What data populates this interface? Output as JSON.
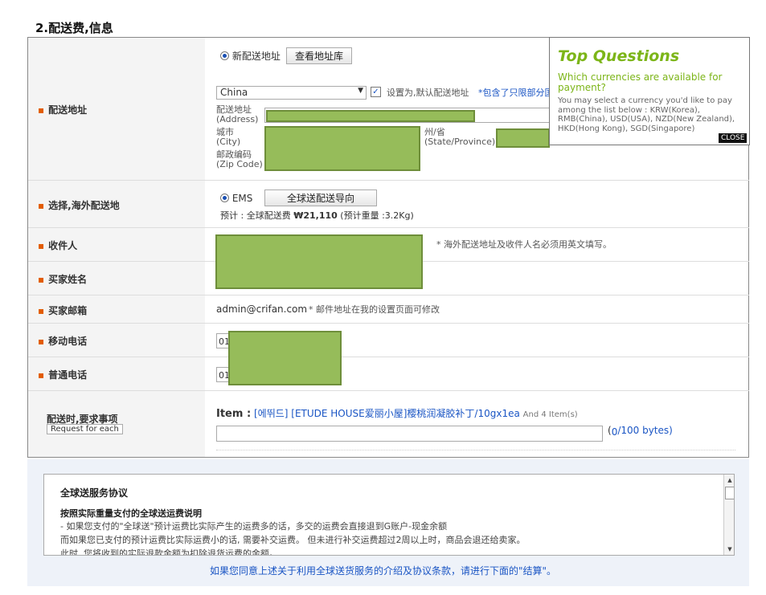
{
  "section_title": "2.配送费,信息",
  "address": {
    "label": "配送地址",
    "new_address_radio": "新配送地址",
    "view_book_button": "查看地址库",
    "country_select": "China",
    "default_checkbox_label": "设置为,默认配送地址",
    "default_note": "*包含了只限部分国",
    "address_label_cn": "配送地址",
    "address_label_en": "(Address)",
    "city_label_cn": "城市",
    "city_label_en": "(City)",
    "state_label_cn": "州/省",
    "state_label_en": "(State/Province)",
    "zip_label_cn": "邮政编码",
    "zip_label_en": "(Zip Code)"
  },
  "shipping": {
    "label": "选择,海外配送地",
    "radio": "EMS",
    "guide_button": "全球送配送导向",
    "estimate_prefix": "预计 : 全球配送费 ",
    "estimate_amount": "₩21,110",
    "estimate_suffix": " (预计重量 :3.2Kg)"
  },
  "recipient": {
    "label": "收件人",
    "note": "* 海外配送地址及收件人名必须用英文填写。"
  },
  "buyer_name": {
    "label": "买家姓名"
  },
  "buyer_email": {
    "label": "买家邮箱",
    "value": "admin@crifan.com",
    "note": "* 邮件地址在我的设置页面可修改"
  },
  "mobile": {
    "label": "移动电话",
    "prefix": "01"
  },
  "phone": {
    "label": "普通电话",
    "prefix": "01"
  },
  "request": {
    "label": "配送时,要求事项",
    "button": "Request for each",
    "item_label": "Item :",
    "item_link": "[에뛰드] [ETUDE HOUSE爱丽小屋]樱桃润凝胶补丁/10gx1ea",
    "item_count": "And 4 Item(s)",
    "byte_counter_open": "(",
    "byte_counter_value": "0",
    "byte_counter_rest": "/100 bytes)"
  },
  "faq_popup": {
    "title": "Top Questions",
    "question": "Which currencies are available for payment?",
    "answer": "You may select a currency you'd like to pay among the list below : KRW(Korea), RMB(China), USD(USA), NZD(New Zealand), HKD(Hong Kong), SGD(Singapore)",
    "close": "CLOSE"
  },
  "agreement": {
    "title": "全球送服务协议",
    "subtitle": "按照实际重量支付的全球送运费说明",
    "line1": "- 如果您支付的\"全球送\"预计运费比实际产生的运费多的话，多交的运费会直接退到G账户-现金余额",
    "line2": "  而如果您已支付的预计运费比实际运费小的话, 需要补交运费。 但未进行补交运费超过2周以上时，商品会退还给卖家。",
    "line3": "  此时, 您将收到的实际退款金额为扣除退货运费的金额。",
    "note": "如果您同意上述关于利用全球送货服务的介绍及协议条款，请进行下面的\"结算\"。"
  }
}
